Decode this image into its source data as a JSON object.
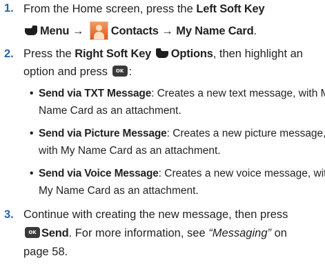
{
  "steps": [
    {
      "number": "1.",
      "line1": {
        "text": "From the Home screen, press the ",
        "bold": "Left Soft Key"
      },
      "line2": {
        "menu": "Menu",
        "arrow1": "→",
        "contacts": "Contacts",
        "arrow2": "→",
        "name_card": "My Name Card",
        "end": "."
      }
    },
    {
      "number": "2.",
      "line1": {
        "text": "Press the ",
        "bold": "Right Soft Key",
        "options": "Options",
        "after": ", then highlight an"
      },
      "line2": {
        "text": "option and press",
        "end": ":"
      },
      "bullets": [
        {
          "title": "Send via TXT Message",
          "line1": ": Creates a new text message, with My",
          "line2": "Name Card as an attachment."
        },
        {
          "title": "Send via Picture Message",
          "line1": ": Creates a new picture message,",
          "line2": "with My Name Card as an attachment."
        },
        {
          "title": "Send via Voice Message",
          "line1": ": Creates a new voice message, with",
          "line2": "My Name Card as an attachment."
        }
      ]
    },
    {
      "number": "3.",
      "line1": "Continue with creating the new message, then press",
      "line2": {
        "send": "Send",
        "text": ". For more information, see ",
        "link": "“Messaging”",
        "after": " on"
      },
      "line3": "page 58."
    }
  ],
  "icons": {
    "ok_key": "OK",
    "left_soft_key": "left-soft-key-icon",
    "right_soft_key": "right-soft-key-icon",
    "contacts": "contacts-icon"
  },
  "colors": {
    "step_number": "#2b63a7",
    "text": "#231f20"
  }
}
